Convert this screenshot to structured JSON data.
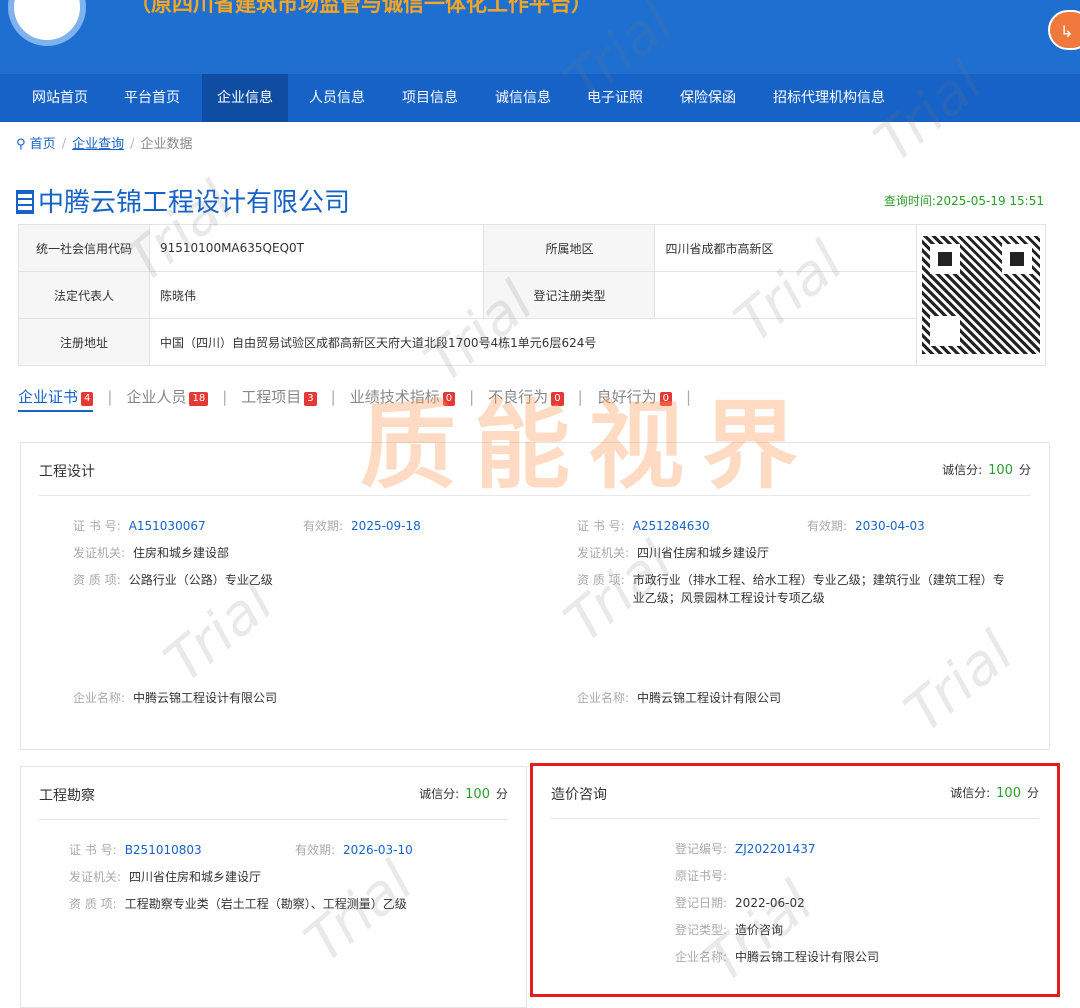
{
  "header": {
    "subtitle": "（原四川省建筑市场监管与诚信一体化工作平台）"
  },
  "nav": {
    "items": [
      "网站首页",
      "平台首页",
      "企业信息",
      "人员信息",
      "项目信息",
      "诚信信息",
      "电子证照",
      "保险保函",
      "招标代理机构信息"
    ],
    "active": "企业信息"
  },
  "breadcrumb": {
    "home": "首页",
    "query": "企业查询",
    "current": "企业数据"
  },
  "company": {
    "name": "中腾云锦工程设计有限公司",
    "query_time": "查询时间:2025-05-19 15:51"
  },
  "info": {
    "credit_code_label": "统一社会信用代码",
    "credit_code": "91510100MA635QEQ0T",
    "region_label": "所属地区",
    "region": "四川省成都市高新区",
    "legal_rep_label": "法定代表人",
    "legal_rep": "陈晓伟",
    "reg_type_label": "登记注册类型",
    "reg_type": "",
    "address_label": "注册地址",
    "address": "中国（四川）自由贸易试验区成都高新区天府大道北段1700号4栋1单元6层624号"
  },
  "tabs": [
    {
      "label": "企业证书",
      "count": "4"
    },
    {
      "label": "企业人员",
      "count": "18"
    },
    {
      "label": "工程项目",
      "count": "3"
    },
    {
      "label": "业绩技术指标",
      "count": "0"
    },
    {
      "label": "不良行为",
      "count": "0"
    },
    {
      "label": "良好行为",
      "count": "0"
    }
  ],
  "labels": {
    "score": "诚信分:",
    "score_unit": "分",
    "cert_no": "证 书 号:",
    "valid": "有效期:",
    "issuer": "发证机关:",
    "qual": "资 质 项:",
    "company": "企业名称:",
    "reg_no": "登记编号:",
    "orig_cert": "原证书号:",
    "reg_date": "登记日期:",
    "reg_type": "登记类型:"
  },
  "design_card": {
    "title": "工程设计",
    "score": "100",
    "left": {
      "cert_no": "A151030067",
      "valid": "2025-09-18",
      "issuer": "住房和城乡建设部",
      "qual": "公路行业（公路）专业乙级",
      "company": "中腾云锦工程设计有限公司"
    },
    "right": {
      "cert_no": "A251284630",
      "valid": "2030-04-03",
      "issuer": "四川省住房和城乡建设厅",
      "qual": "市政行业（排水工程、给水工程）专业乙级；建筑行业（建筑工程）专业乙级；风景园林工程设计专项乙级",
      "company": "中腾云锦工程设计有限公司"
    }
  },
  "survey_card": {
    "title": "工程勘察",
    "score": "100",
    "cert_no": "B251010803",
    "valid": "2026-03-10",
    "issuer": "四川省住房和城乡建设厅",
    "qual": "工程勘察专业类（岩土工程（勘察）、工程测量）乙级"
  },
  "cost_card": {
    "title": "造价咨询",
    "score": "100",
    "reg_no": "ZJ202201437",
    "orig_cert": "",
    "reg_date": "2022-06-02",
    "reg_type": "造价咨询",
    "company": "中腾云锦工程设计有限公司"
  },
  "watermark": {
    "brand": "质能视界",
    "trial": "Trial"
  },
  "colors": {
    "primary": "#1762c6",
    "score_green": "#2a9d2a",
    "badge_red": "#e53935",
    "highlight_red": "#e02020"
  }
}
